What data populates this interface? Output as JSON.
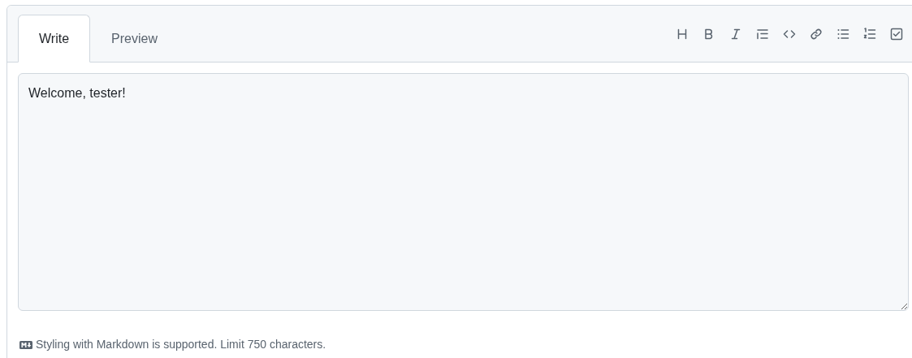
{
  "tabs": [
    {
      "label": "Write",
      "selected": true
    },
    {
      "label": "Preview",
      "selected": false
    }
  ],
  "toolbar": [
    {
      "kind": "heading"
    },
    {
      "kind": "bold"
    },
    {
      "kind": "italic"
    },
    {
      "kind": "quote"
    },
    {
      "kind": "code"
    },
    {
      "kind": "link"
    },
    {
      "kind": "bullet-list"
    },
    {
      "kind": "numbered-list"
    },
    {
      "kind": "task-list"
    }
  ],
  "editor": {
    "value": "Welcome, tester!"
  },
  "footer": {
    "text": "Styling with Markdown is supported. Limit 750 characters."
  }
}
